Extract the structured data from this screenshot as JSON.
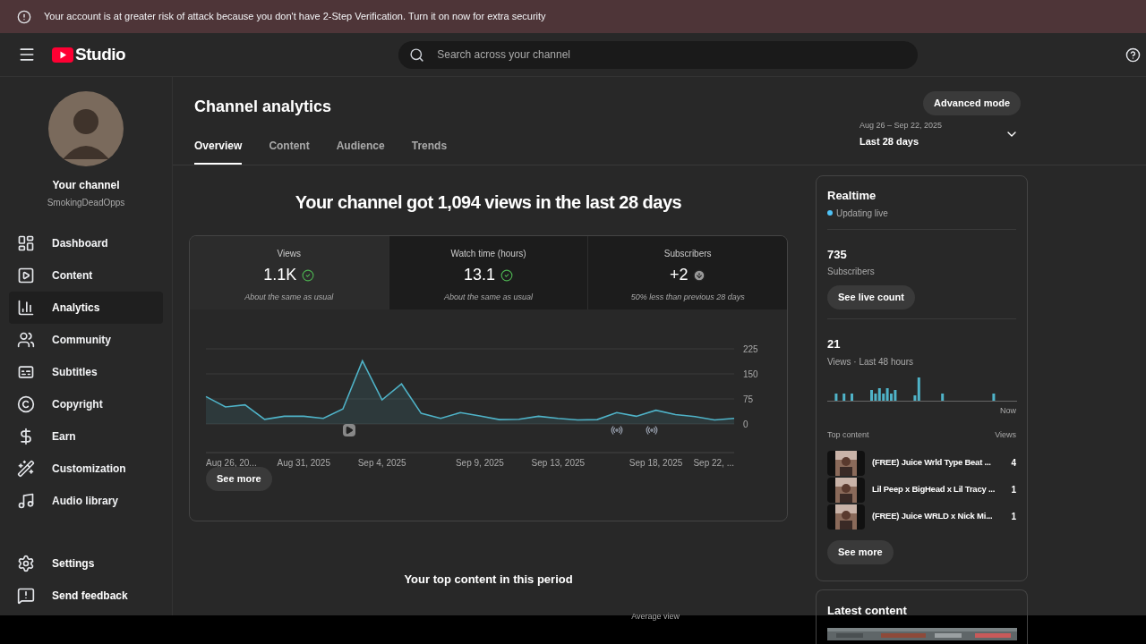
{
  "banner": {
    "text": "Your account is at greater risk of attack because you don't have 2-Step Verification. Turn it on now for extra security"
  },
  "header": {
    "logo": "Studio",
    "search": {
      "placeholder": "Search across your channel"
    }
  },
  "channel": {
    "title": "Your channel",
    "handle": "SmokingDeadOpps"
  },
  "sidebar": {
    "items": [
      {
        "label": "Dashboard",
        "selected": false
      },
      {
        "label": "Content",
        "selected": false
      },
      {
        "label": "Analytics",
        "selected": true
      },
      {
        "label": "Community",
        "selected": false
      },
      {
        "label": "Subtitles",
        "selected": false
      },
      {
        "label": "Copyright",
        "selected": false
      },
      {
        "label": "Earn",
        "selected": false
      },
      {
        "label": "Customization",
        "selected": false
      },
      {
        "label": "Audio library",
        "selected": false
      }
    ],
    "footer": [
      {
        "label": "Settings"
      },
      {
        "label": "Send feedback"
      }
    ]
  },
  "page": {
    "title": "Channel analytics",
    "advanced_button": "Advanced mode",
    "date_range": "Aug 26 – Sep 22, 2025",
    "period": "Last 28 days",
    "tabs": [
      {
        "label": "Overview",
        "selected": true
      },
      {
        "label": "Content",
        "selected": false
      },
      {
        "label": "Audience",
        "selected": false
      },
      {
        "label": "Trends",
        "selected": false
      }
    ]
  },
  "overview": {
    "headline": "Your channel got 1,094 views in the last 28 days",
    "metrics": [
      {
        "label": "Views",
        "value": "1.1K",
        "kind": "ok",
        "note": "About the same as usual",
        "selected": true
      },
      {
        "label": "Watch time (hours)",
        "value": "13.1",
        "kind": "ok",
        "note": "About the same as usual",
        "selected": false
      },
      {
        "label": "Subscribers",
        "value": "+2",
        "kind": "down",
        "note": "50% less than previous 28 days",
        "selected": false
      }
    ],
    "chart_data": {
      "type": "area",
      "yticks": [
        0,
        75,
        150,
        225
      ],
      "ylim": [
        0,
        225
      ],
      "series": [
        {
          "color": "#4fb3c8",
          "values": [
            82,
            51,
            57,
            14,
            23,
            23,
            17,
            45,
            189,
            72,
            120,
            32,
            17,
            34,
            24,
            13,
            14,
            23,
            17,
            12,
            13,
            34,
            23,
            41,
            28,
            22,
            12,
            17
          ]
        }
      ]
    },
    "axis_labels": [
      "Aug 26, 20...",
      "Aug 31, 2025",
      "Sep 4, 2025",
      "Sep 9, 2025",
      "Sep 13, 2025",
      "Sep 18, 2025",
      "Sep 22, ..."
    ],
    "see_more": "See more"
  },
  "realtime": {
    "title": "Realtime",
    "status": "Updating live",
    "subscribers": "735",
    "subscribers_label": "Subscribers",
    "live_button": "See live count",
    "views": "21",
    "views_label": "Views · Last 48 hours",
    "now_label": "Now",
    "top_heading": "Top content",
    "views_heading": "Views",
    "top": [
      {
        "title": "(FREE) Juice Wrld Type Beat ...",
        "views": "4"
      },
      {
        "title": "Lil Peep x BigHead x Lil Tracy ...",
        "views": "1"
      },
      {
        "title": "(FREE) Juice WRLD x Nick Mi...",
        "views": "1"
      }
    ],
    "see_more": "See more"
  },
  "top_content": {
    "title": "Your top content in this period",
    "column": "Average view"
  },
  "latest": {
    "title": "Latest content"
  }
}
